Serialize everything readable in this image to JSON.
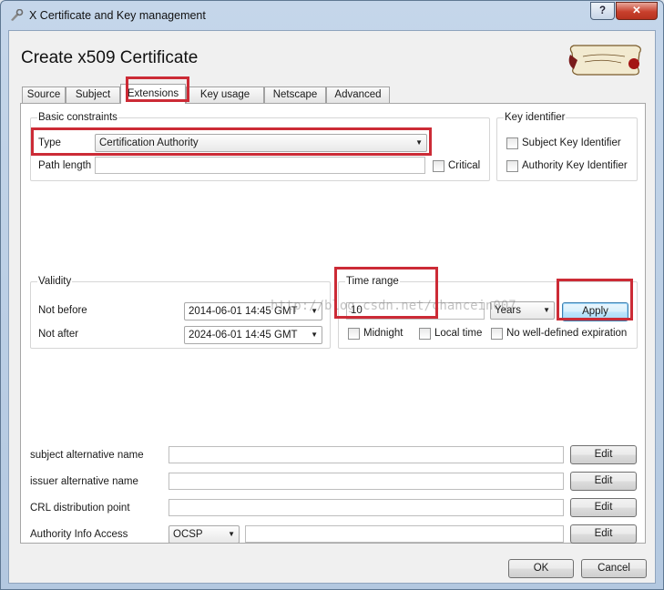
{
  "window": {
    "title": "X Certificate and Key management",
    "help_label": "?",
    "close_label": "✕"
  },
  "header": {
    "title": "Create x509 Certificate"
  },
  "tabs": [
    {
      "label": "Source"
    },
    {
      "label": "Subject"
    },
    {
      "label": "Extensions"
    },
    {
      "label": "Key usage"
    },
    {
      "label": "Netscape"
    },
    {
      "label": "Advanced"
    }
  ],
  "basic_constraints": {
    "title": "Basic constraints",
    "type_label": "Type",
    "type_value": "Certification Authority",
    "path_length_label": "Path length",
    "path_length_value": "",
    "critical_label": "Critical"
  },
  "key_identifier": {
    "title": "Key identifier",
    "subject_label": "Subject Key Identifier",
    "authority_label": "Authority Key Identifier"
  },
  "validity": {
    "title": "Validity",
    "not_before_label": "Not before",
    "not_before_value": "2014-06-01 14:45 GMT",
    "not_after_label": "Not after",
    "not_after_value": "2024-06-01 14:45 GMT"
  },
  "time_range": {
    "title": "Time range",
    "value": "10",
    "unit": "Years",
    "apply_label": "Apply",
    "midnight_label": "Midnight",
    "local_time_label": "Local time",
    "no_expiration_label": "No well-defined expiration"
  },
  "alt_names": {
    "subject_alt_label": "subject alternative name",
    "issuer_alt_label": "issuer alternative name",
    "crl_label": "CRL distribution point",
    "aia_label": "Authority Info Access",
    "aia_method": "OCSP",
    "edit_label": "Edit"
  },
  "footer": {
    "ok_label": "OK",
    "cancel_label": "Cancel"
  },
  "watermark": "http://blog.csdn.net/chancein007"
}
